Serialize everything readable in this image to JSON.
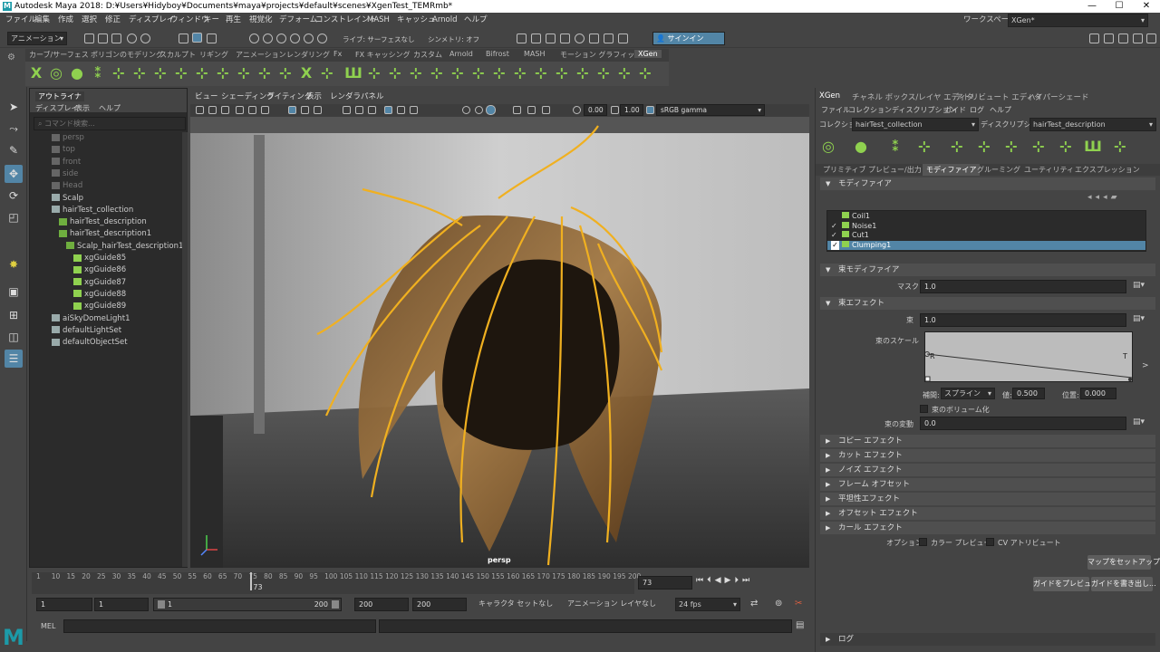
{
  "window": {
    "title": "Autodesk Maya 2018: D:¥Users¥Hidyboy¥Documents¥maya¥projects¥default¥scenes¥XgenTest_TEMRmb*",
    "logo": "M",
    "controls": [
      "—",
      "☐",
      "✕"
    ]
  },
  "menubar": {
    "items": [
      "ファイル",
      "編集",
      "作成",
      "選択",
      "修正",
      "ディスプレイ",
      "ウィンドウ",
      "キー",
      "再生",
      "視覚化",
      "デフォーム",
      "コンストレイント",
      "MASH",
      "キャッシュ",
      "Arnold",
      "ヘルプ"
    ],
    "workspace_label": "ワークスペース:",
    "workspace_value": "XGen*"
  },
  "toolbar": {
    "mode": "アニメーション",
    "live_surface": "ライブ: サーフェスなし",
    "symmetry": "シンメトリ: オフ",
    "signin": "サインイン"
  },
  "shelf": {
    "tabs": [
      "カーブ/サーフェス",
      "ポリゴンのモデリング",
      "スカルプト",
      "リギング",
      "アニメーション",
      "レンダリング",
      "Fx",
      "FX キャッシング",
      "カスタム",
      "Arnold",
      "Bifrost",
      "MASH",
      "モーション グラフィックス",
      "XGen"
    ],
    "active": "XGen"
  },
  "outliner": {
    "tab": "アウトライナ",
    "menus": [
      "ディスプレイ",
      "表示",
      "ヘルプ"
    ],
    "search_placeholder": "コマンド検索...",
    "items": [
      {
        "label": "persp",
        "dim": true,
        "indent": 0
      },
      {
        "label": "top",
        "dim": true,
        "indent": 0
      },
      {
        "label": "front",
        "dim": true,
        "indent": 0
      },
      {
        "label": "side",
        "dim": true,
        "indent": 0
      },
      {
        "label": "Head",
        "dim": true,
        "indent": 0
      },
      {
        "label": "Scalp",
        "dim": false,
        "indent": 0
      },
      {
        "label": "hairTest_collection",
        "dim": false,
        "indent": 0
      },
      {
        "label": "hairTest_description",
        "dim": false,
        "indent": 1
      },
      {
        "label": "hairTest_description1",
        "dim": false,
        "indent": 1
      },
      {
        "label": "Scalp_hairTest_description1",
        "dim": false,
        "indent": 2
      },
      {
        "label": "xgGuide85",
        "dim": false,
        "indent": 3
      },
      {
        "label": "xgGuide86",
        "dim": false,
        "indent": 3
      },
      {
        "label": "xgGuide87",
        "dim": false,
        "indent": 3
      },
      {
        "label": "xgGuide88",
        "dim": false,
        "indent": 3
      },
      {
        "label": "xgGuide89",
        "dim": false,
        "indent": 3
      },
      {
        "label": "aiSkyDomeLight1",
        "dim": false,
        "indent": 0
      },
      {
        "label": "defaultLightSet",
        "dim": false,
        "indent": 0
      },
      {
        "label": "defaultObjectSet",
        "dim": false,
        "indent": 0
      }
    ]
  },
  "viewport": {
    "menus": [
      "ビュー",
      "シェーディング",
      "ライティング",
      "表示",
      "レンダラ",
      "パネル"
    ],
    "exposure": "0.00",
    "gamma": "1.00",
    "colorspace": "sRGB gamma",
    "camera": "persp"
  },
  "timeline": {
    "ticks": [
      "1",
      "10",
      "15",
      "20",
      "25",
      "30",
      "35",
      "40",
      "45",
      "50",
      "55",
      "60",
      "65",
      "70",
      "75",
      "80",
      "85",
      "90",
      "95",
      "100",
      "105",
      "110",
      "115",
      "120",
      "125",
      "130",
      "135",
      "140",
      "145",
      "150",
      "155",
      "160",
      "165",
      "170",
      "175",
      "180",
      "185",
      "190",
      "195",
      "200"
    ],
    "current_label": "73",
    "current_frame": "73",
    "current_fraction": 0.362
  },
  "range": {
    "start": "1",
    "anim_start": "1",
    "slider_start": "1",
    "slider_end": "200",
    "anim_end": "200",
    "end": "200",
    "character": "キャラクタ セットなし",
    "anim_layer": "アニメーション レイヤなし",
    "fps": "24 fps"
  },
  "mel": {
    "label": "MEL"
  },
  "xgen": {
    "tabs": [
      "XGen",
      "チャネル ボックス/レイヤ エディタ",
      "アトリビュート エディタ",
      "ハイパーシェード"
    ],
    "menus": [
      "ファイル",
      "コレクション",
      "ディスクリプション",
      "ガイド",
      "ログ",
      "ヘルプ"
    ],
    "collection_label": "コレクション",
    "collection_value": "hairTest_collection",
    "description_label": "ディスクリプション",
    "description_value": "hairTest_description",
    "subtabs": [
      "プリミティブ",
      "プレビュー/出力",
      "モディファイア",
      "グルーミング",
      "ユーティリティ",
      "エクスプレッション"
    ],
    "active_subtab": "モディファイア",
    "modifier_section": "モディファイア",
    "modifiers": [
      {
        "name": "Coil1",
        "checked": false
      },
      {
        "name": "Noise1",
        "checked": true
      },
      {
        "name": "Cut1",
        "checked": true
      },
      {
        "name": "Clumping1",
        "checked": true,
        "selected": true
      }
    ],
    "clump_modifier_section": "束モディファイア",
    "mask_label": "マスク",
    "mask_value": "1.0",
    "clump_effect_section": "束エフェクト",
    "clump_label": "束",
    "clump_value": "1.0",
    "clump_scale_label": "束のスケール",
    "curve_r": "R",
    "curve_t": "T",
    "interp_label": "補間:",
    "interp_value": "スプライン",
    "value_label": "値:",
    "value_value": "0.500",
    "pos_label": "位置:",
    "pos_value": "0.000",
    "volume_label": "束のボリューム化",
    "variation_label": "束の変動",
    "variation_value": "0.0",
    "effects": [
      "コピー エフェクト",
      "カット エフェクト",
      "ノイズ エフェクト",
      "フレーム オフセット",
      "平坦性エフェクト",
      "オフセット エフェクト",
      "カール エフェクト"
    ],
    "option_label": "オプション",
    "color_preview": "カラー プレビュー",
    "cv_attr": "CV アトリビュート",
    "map_button": "マップをセットアップ...",
    "preview_button": "ガイドをプレビュー",
    "write_button": "ガイドを書き出し...",
    "log_section": "ログ"
  }
}
